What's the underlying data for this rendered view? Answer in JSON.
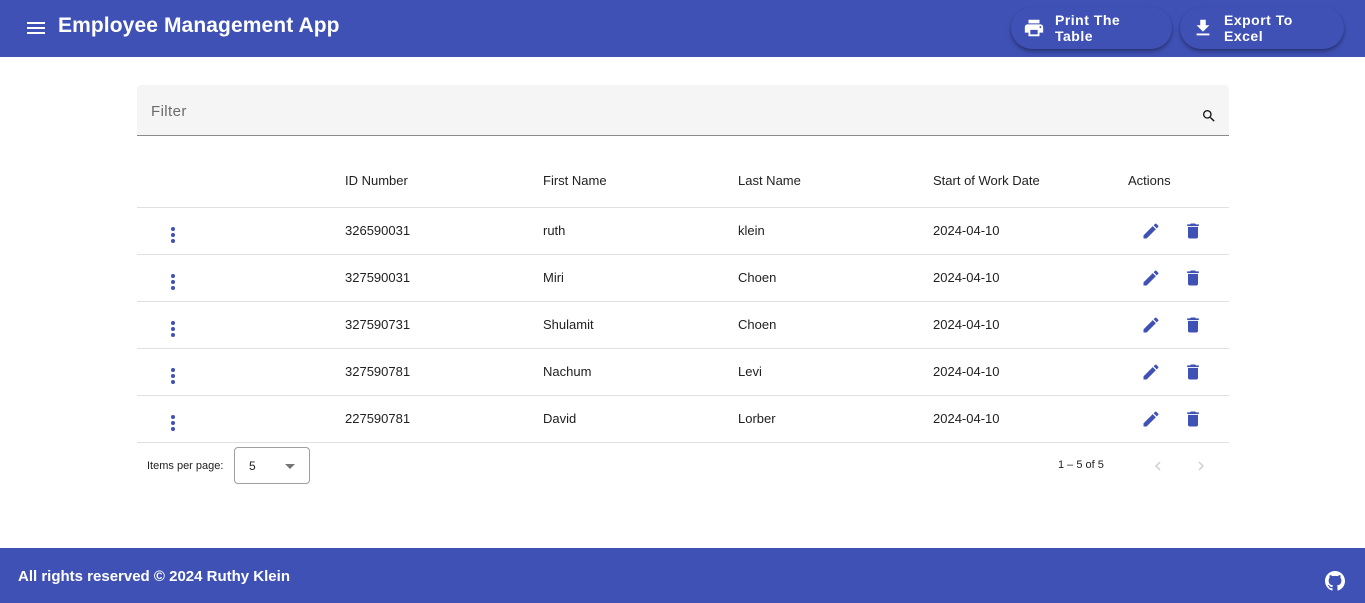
{
  "header": {
    "title": "Employee Management App",
    "print_label": "Print The Table",
    "export_label": "Export To Excel",
    "background_color": "#3f51b5"
  },
  "filter": {
    "placeholder": "Filter",
    "value": ""
  },
  "table": {
    "columns": {
      "id": "ID Number",
      "first": "First Name",
      "last": "Last Name",
      "date": "Start of Work Date",
      "actions": "Actions"
    },
    "rows": [
      {
        "id": "326590031",
        "first": "ruth",
        "last": "klein",
        "date": "2024-04-10"
      },
      {
        "id": "327590031",
        "first": "Miri",
        "last": "Choen",
        "date": "2024-04-10"
      },
      {
        "id": "327590731",
        "first": "Shulamit",
        "last": "Choen",
        "date": "2024-04-10"
      },
      {
        "id": "327590781",
        "first": "Nachum",
        "last": "Levi",
        "date": "2024-04-10"
      },
      {
        "id": "227590781",
        "first": "David",
        "last": "Lorber",
        "date": "2024-04-10"
      }
    ],
    "row_icons": [
      "more-vert-icon",
      "edit-icon",
      "delete-icon"
    ],
    "accent_color": "#3f51b5"
  },
  "paginator": {
    "items_per_page_label": "Items per page:",
    "items_per_page": "5",
    "range_label": "1 – 5 of 5"
  },
  "footer": {
    "copyright": "All rights reserved © 2024 Ruthy Klein"
  }
}
